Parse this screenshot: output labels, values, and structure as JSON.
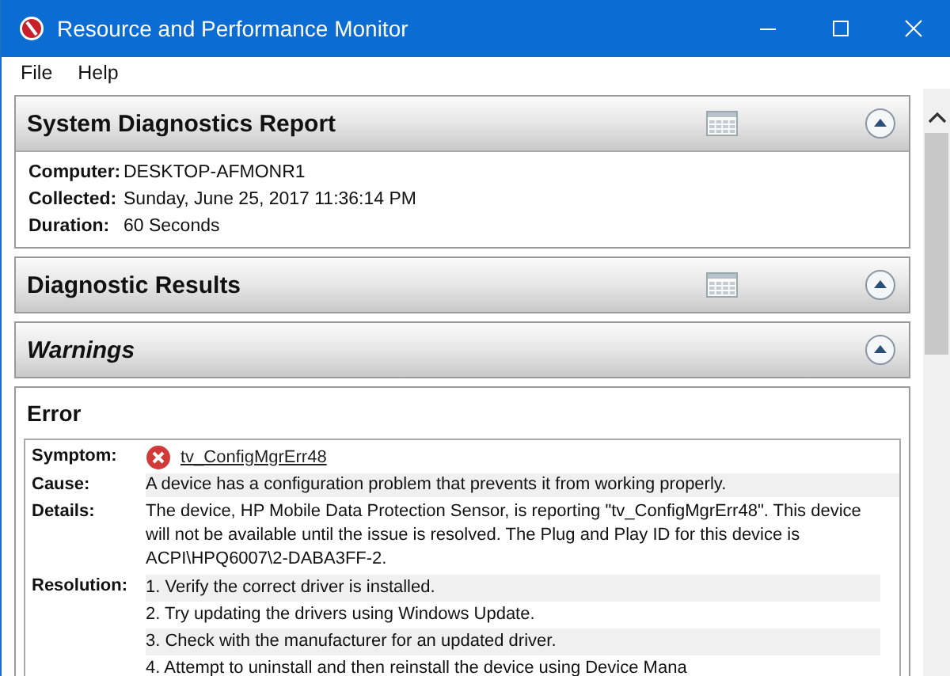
{
  "window": {
    "title": "Resource and Performance Monitor"
  },
  "menu": [
    "File",
    "Help"
  ],
  "sections": [
    {
      "kind": "report",
      "title": "System Diagnostics Report",
      "expanded": true,
      "fields": [
        {
          "label": "Computer:",
          "value": "DESKTOP-AFMONR1"
        },
        {
          "label": "Collected:",
          "value": "Sunday, June 25, 2017 11:36:14 PM"
        },
        {
          "label": "Duration:",
          "value": "60 Seconds"
        }
      ]
    },
    {
      "kind": "results",
      "title": "Diagnostic Results",
      "expanded": true
    },
    {
      "kind": "warnings",
      "title": "Warnings",
      "expanded": true
    }
  ],
  "error": {
    "title": "Error",
    "symptom": {
      "label": "Symptom:",
      "link": "tv_ConfigMgrErr48"
    },
    "cause": {
      "label": "Cause:",
      "text": "A device has a configuration problem that prevents it from working properly."
    },
    "details": {
      "label": "Details:",
      "text": "The device, HP Mobile Data Protection Sensor, is reporting \"tv_ConfigMgrErr48\". This device will not be available until the issue is resolved. The Plug and Play ID for this device is ACPI\\HPQ6007\\2-DABA3FF-2."
    },
    "resolution": {
      "label": "Resolution:",
      "steps": [
        "1. Verify the correct driver is installed.",
        "2. Try updating the drivers using Windows Update.",
        "3. Check with the manufacturer for an updated driver.",
        "4. Attempt to uninstall and then reinstall the device using Device Mana"
      ]
    }
  }
}
